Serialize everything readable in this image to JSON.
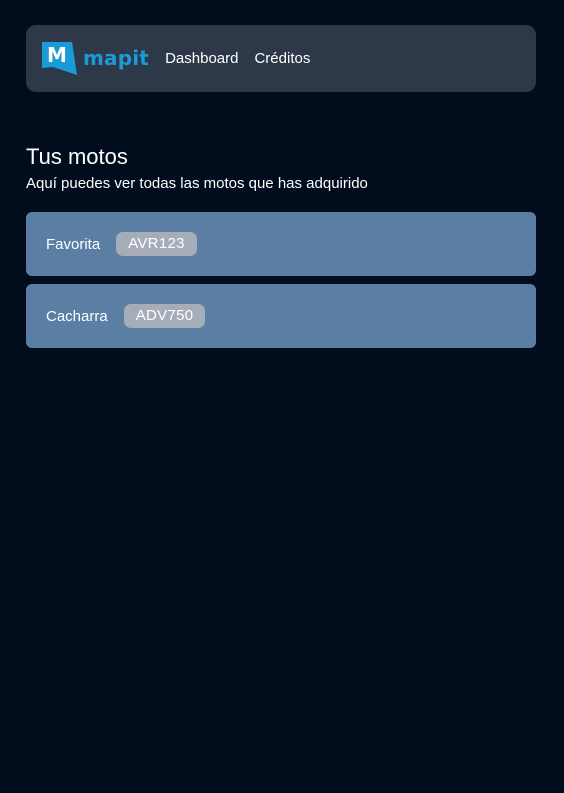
{
  "nav": {
    "brand_name": "mapit",
    "brand_logo_letter": "M",
    "links": [
      {
        "label": "Dashboard"
      },
      {
        "label": "Créditos"
      }
    ]
  },
  "main": {
    "title": "Tus motos",
    "subtitle": "Aquí puedes ver todas las motos que has adquirido",
    "motos": [
      {
        "name": "Favorita",
        "plate": "AVR123"
      },
      {
        "name": "Cacharra",
        "plate": "ADV750"
      }
    ]
  },
  "colors": {
    "background": "#010c1c",
    "navbar": "#2d3848",
    "brand": "#1a9ad6",
    "card": "#5b7ea5",
    "plate_badge": "#a6acb8"
  }
}
